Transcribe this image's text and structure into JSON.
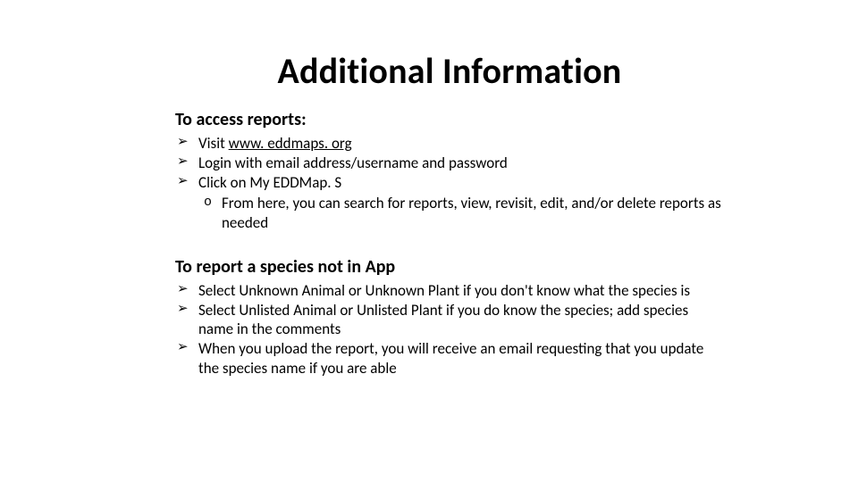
{
  "title": "Additional Information",
  "section1": {
    "heading": "To access reports:",
    "items": [
      {
        "prefix": "Visit ",
        "link": "www. eddmaps. org",
        "suffix": ""
      },
      {
        "text": "Login with email address/username and password"
      },
      {
        "text": "Click on My EDDMap. S",
        "sub": [
          "From here, you can search for reports, view, revisit, edit, and/or delete reports as needed"
        ]
      }
    ]
  },
  "section2": {
    "heading": "To report a species not in App",
    "items": [
      "Select Unknown Animal or Unknown Plant if you don't know what the species is",
      "Select Unlisted Animal or Unlisted Plant if you do know the species; add species name in the comments",
      "When you upload the report, you will receive an email requesting that you update the species name if you are able"
    ]
  }
}
